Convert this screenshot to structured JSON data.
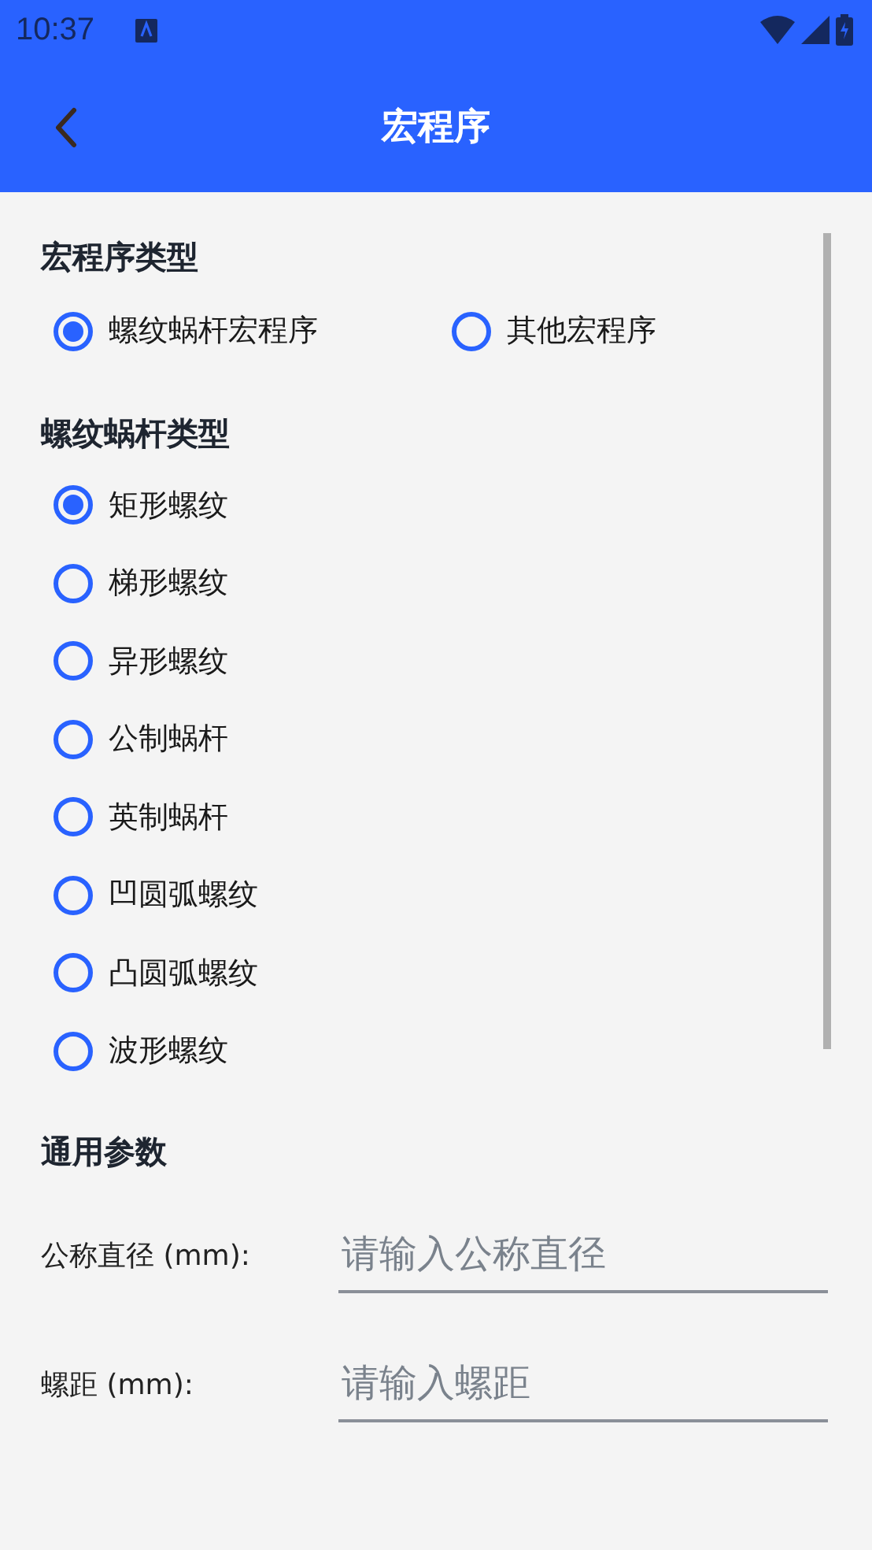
{
  "status_bar": {
    "time": "10:37"
  },
  "app_bar": {
    "title": "宏程序"
  },
  "macro_type": {
    "heading": "宏程序类型",
    "options": [
      {
        "label": "螺纹蜗杆宏程序",
        "selected": true
      },
      {
        "label": "其他宏程序",
        "selected": false
      }
    ]
  },
  "thread_type": {
    "heading": "螺纹蜗杆类型",
    "options": [
      {
        "label": "矩形螺纹",
        "selected": true
      },
      {
        "label": "梯形螺纹",
        "selected": false
      },
      {
        "label": "异形螺纹",
        "selected": false
      },
      {
        "label": "公制蜗杆",
        "selected": false
      },
      {
        "label": "英制蜗杆",
        "selected": false
      },
      {
        "label": "凹圆弧螺纹",
        "selected": false
      },
      {
        "label": "凸圆弧螺纹",
        "selected": false
      },
      {
        "label": "波形螺纹",
        "selected": false
      }
    ]
  },
  "common_params": {
    "heading": "通用参数",
    "fields": [
      {
        "label": "公称直径 (mm):",
        "placeholder": "请输入公称直径"
      },
      {
        "label": "螺距 (mm):",
        "placeholder": "请输入螺距"
      }
    ]
  }
}
